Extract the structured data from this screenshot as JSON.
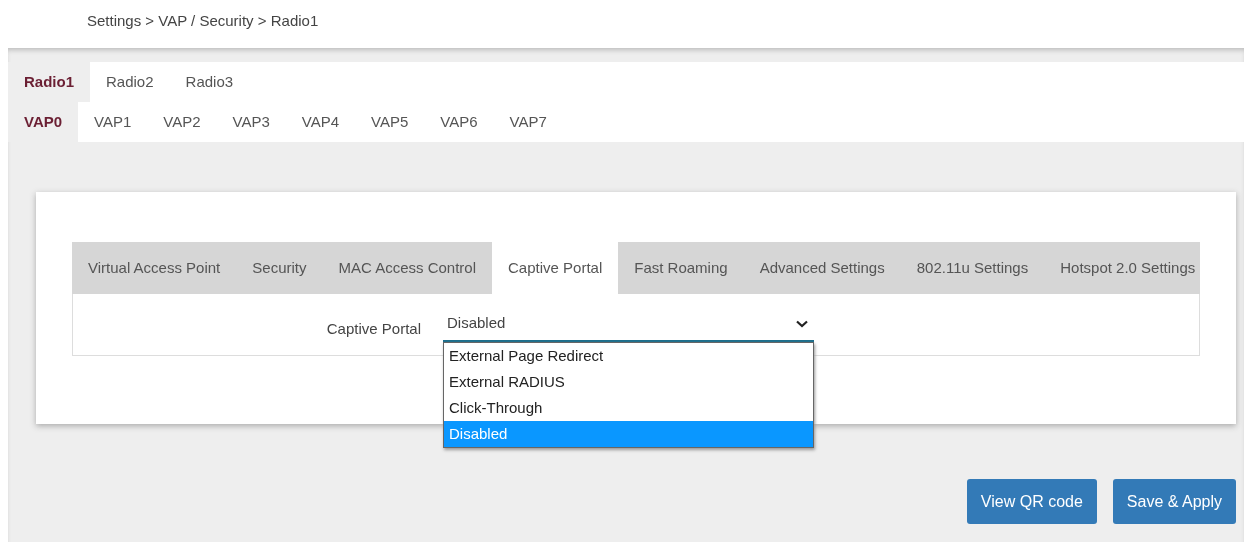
{
  "breadcrumb": "Settings > VAP / Security > Radio1",
  "radio_tabs": [
    {
      "label": "Radio1",
      "selected": true
    },
    {
      "label": "Radio2",
      "selected": false
    },
    {
      "label": "Radio3",
      "selected": false
    }
  ],
  "vap_tabs": [
    {
      "label": "VAP0",
      "selected": true
    },
    {
      "label": "VAP1",
      "selected": false
    },
    {
      "label": "VAP2",
      "selected": false
    },
    {
      "label": "VAP3",
      "selected": false
    },
    {
      "label": "VAP4",
      "selected": false
    },
    {
      "label": "VAP5",
      "selected": false
    },
    {
      "label": "VAP6",
      "selected": false
    },
    {
      "label": "VAP7",
      "selected": false
    }
  ],
  "settings_tabs": [
    {
      "label": "Virtual Access Point",
      "selected": false
    },
    {
      "label": "Security",
      "selected": false
    },
    {
      "label": "MAC Access Control",
      "selected": false
    },
    {
      "label": "Captive Portal",
      "selected": true
    },
    {
      "label": "Fast Roaming",
      "selected": false
    },
    {
      "label": "Advanced Settings",
      "selected": false
    },
    {
      "label": "802.11u Settings",
      "selected": false
    },
    {
      "label": "Hotspot 2.0 Settings",
      "selected": false
    }
  ],
  "field": {
    "label": "Captive Portal",
    "value": "Disabled",
    "expanded": true,
    "options": [
      {
        "label": "External Page Redirect",
        "selected": false
      },
      {
        "label": "External RADIUS",
        "selected": false
      },
      {
        "label": "Click-Through",
        "selected": false
      },
      {
        "label": "Disabled",
        "selected": true
      }
    ]
  },
  "buttons": [
    "View QR code",
    "Save & Apply"
  ]
}
